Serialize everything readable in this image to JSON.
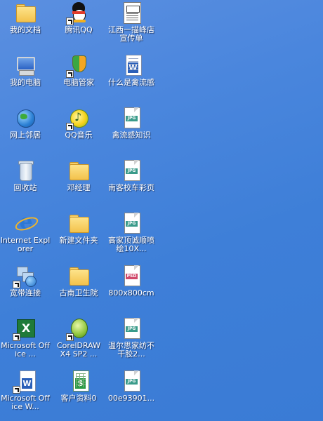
{
  "desktop": {
    "icons": [
      {
        "label": "我的文档",
        "icon": "folder-icon",
        "shortcut": false
      },
      {
        "label": "我的电脑",
        "icon": "computer-icon",
        "shortcut": false
      },
      {
        "label": "网上邻居",
        "icon": "network-places-icon",
        "shortcut": false
      },
      {
        "label": "回收站",
        "icon": "recycle-bin-icon",
        "shortcut": false
      },
      {
        "label": "Internet Explorer",
        "icon": "internet-explorer-icon",
        "shortcut": false
      },
      {
        "label": "宽带连接",
        "icon": "network-connection-icon",
        "shortcut": true
      },
      {
        "label": "Microsoft Office ...",
        "icon": "excel-icon",
        "shortcut": true
      },
      {
        "label": "Microsoft Office W...",
        "icon": "word-icon",
        "shortcut": true
      },
      {
        "label": "腾讯QQ",
        "icon": "qq-penguin-icon",
        "shortcut": true
      },
      {
        "label": "电脑管家",
        "icon": "shield-icon",
        "shortcut": true
      },
      {
        "label": "QQ音乐",
        "icon": "music-icon",
        "shortcut": true
      },
      {
        "label": "邓经理",
        "icon": "folder-icon",
        "shortcut": false
      },
      {
        "label": "新建文件夹",
        "icon": "folder-icon",
        "shortcut": false
      },
      {
        "label": "古南卫生院",
        "icon": "folder-icon",
        "shortcut": false
      },
      {
        "label": "CorelDRAW X4 SP2 ...",
        "icon": "coreldraw-icon",
        "shortcut": true
      },
      {
        "label": "客户资料0",
        "icon": "spreadsheet-icon",
        "shortcut": false
      },
      {
        "label": "江西一描峰店宣传单",
        "icon": "document-icon",
        "shortcut": false
      },
      {
        "label": "什么是禽流感",
        "icon": "word-document-icon",
        "shortcut": false
      },
      {
        "label": "禽流感知识",
        "icon": "jpg-file-icon",
        "shortcut": false
      },
      {
        "label": "南客校车彩页",
        "icon": "jpg-file-icon",
        "shortcut": false
      },
      {
        "label": "高家顶诚顺喷绘10X...",
        "icon": "jpg-file-icon",
        "shortcut": false
      },
      {
        "label": "800x800cm",
        "icon": "psd-file-icon",
        "shortcut": false
      },
      {
        "label": "温尔思家纺不干胶2...",
        "icon": "jpg-file-icon",
        "shortcut": false
      },
      {
        "label": "00e93901...",
        "icon": "jpg-file-icon",
        "shortcut": false
      }
    ],
    "file_tags": {
      "jpg": "JPG",
      "psd": "PSD"
    }
  }
}
